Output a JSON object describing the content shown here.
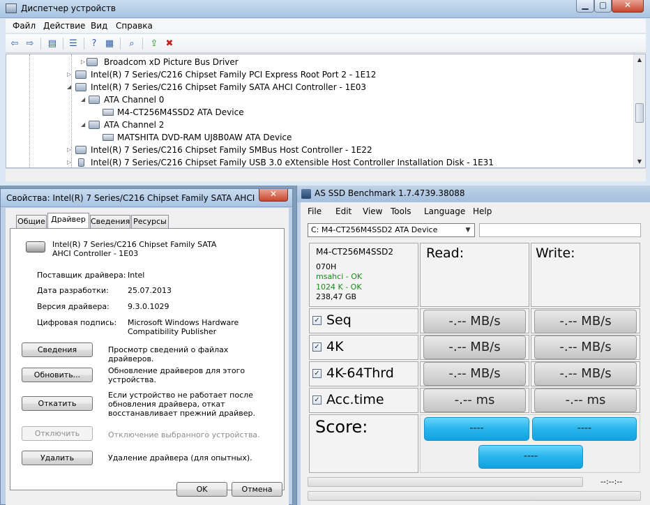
{
  "device_manager": {
    "title": "Диспетчер устройств",
    "menu": [
      "Файл",
      "Действие",
      "Вид",
      "Справка"
    ],
    "tree": [
      {
        "label": "Broadcom xD Picture Bus Driver",
        "icon": "device-icon",
        "indent": 2,
        "exp": ""
      },
      {
        "label": "Intel(R) 7 Series/C216 Chipset Family PCI Express Root Port 2 - 1E12",
        "icon": "device-icon",
        "indent": 1,
        "exp": "▷"
      },
      {
        "label": "Intel(R) 7 Series/C216 Chipset Family SATA AHCI Controller - 1E03",
        "icon": "controller-icon",
        "indent": 1,
        "exp": "◢"
      },
      {
        "label": "ATA Channel 0",
        "icon": "controller-icon",
        "indent": 2,
        "exp": "◢"
      },
      {
        "label": "M4-CT256M4SSD2 ATA Device",
        "icon": "disk-icon",
        "indent": 3,
        "exp": ""
      },
      {
        "label": "ATA Channel 2",
        "icon": "controller-icon",
        "indent": 2,
        "exp": "◢"
      },
      {
        "label": "MATSHITA DVD-RAM UJ8B0AW ATA Device",
        "icon": "dvd-icon",
        "indent": 3,
        "exp": ""
      },
      {
        "label": "Intel(R) 7 Series/C216 Chipset Family SMBus Host Controller - 1E22",
        "icon": "device-icon",
        "indent": 1,
        "exp": "▷"
      },
      {
        "label": "Intel(R) 7 Series/C216 Chipset Family USB 3.0 eXtensible Host Controller Installation Disk - 1E31",
        "icon": "usb-icon",
        "indent": 1,
        "exp": "▷"
      }
    ]
  },
  "properties": {
    "title": "Свойства: Intel(R) 7 Series/C216 Chipset Family SATA AHCI Cont...",
    "tabs": [
      "Общие",
      "Драйвер",
      "Сведения",
      "Ресурсы"
    ],
    "device_name": "Intel(R) 7 Series/C216 Chipset Family SATA AHCI Controller - 1E03",
    "fields": {
      "provider_label": "Поставщик драйвера:",
      "provider_value": "Intel",
      "date_label": "Дата разработки:",
      "date_value": "25.07.2013",
      "version_label": "Версия драйвера:",
      "version_value": "9.3.0.1029",
      "signer_label": "Цифровая подпись:",
      "signer_value": "Microsoft Windows Hardware Compatibility Publisher"
    },
    "buttons": {
      "details": "Сведения",
      "details_desc": "Просмотр сведений о файлах драйверов.",
      "update": "Обновить...",
      "update_desc": "Обновление драйверов для этого устройства.",
      "rollback": "Откатить",
      "rollback_desc": "Если устройство не работает после обновления драйвера, откат восстанавливает прежний драйвер.",
      "disable": "Отключить",
      "disable_desc": "Отключение выбранного устройства.",
      "uninstall": "Удалить",
      "uninstall_desc": "Удаление драйвера (для опытных).",
      "ok": "OK",
      "cancel": "Отмена"
    }
  },
  "as_ssd": {
    "title": "AS SSD Benchmark 1.7.4739.38088",
    "menu": [
      "File",
      "Edit",
      "View",
      "Tools",
      "Language",
      "Help"
    ],
    "drive_select": "C: M4-CT256M4SSD2 ATA Device",
    "info": {
      "model": "M4-CT256M4SSD2",
      "firmware": "070H",
      "driver": "msahci - OK",
      "alignment": "1024 K - OK",
      "size": "238,47 GB"
    },
    "read_header": "Read:",
    "write_header": "Write:",
    "rows": [
      {
        "label": "Seq",
        "read": "-.-- MB/s",
        "write": "-.-- MB/s"
      },
      {
        "label": "4K",
        "read": "-.-- MB/s",
        "write": "-.-- MB/s"
      },
      {
        "label": "4K-64Thrd",
        "read": "-.-- MB/s",
        "write": "-.-- MB/s"
      },
      {
        "label": "Acc.time",
        "read": "-.-- ms",
        "write": "-.-- ms"
      }
    ],
    "score_label": "Score:",
    "score_read": "----",
    "score_write": "----",
    "score_total": "----",
    "time": "--:--:--"
  }
}
